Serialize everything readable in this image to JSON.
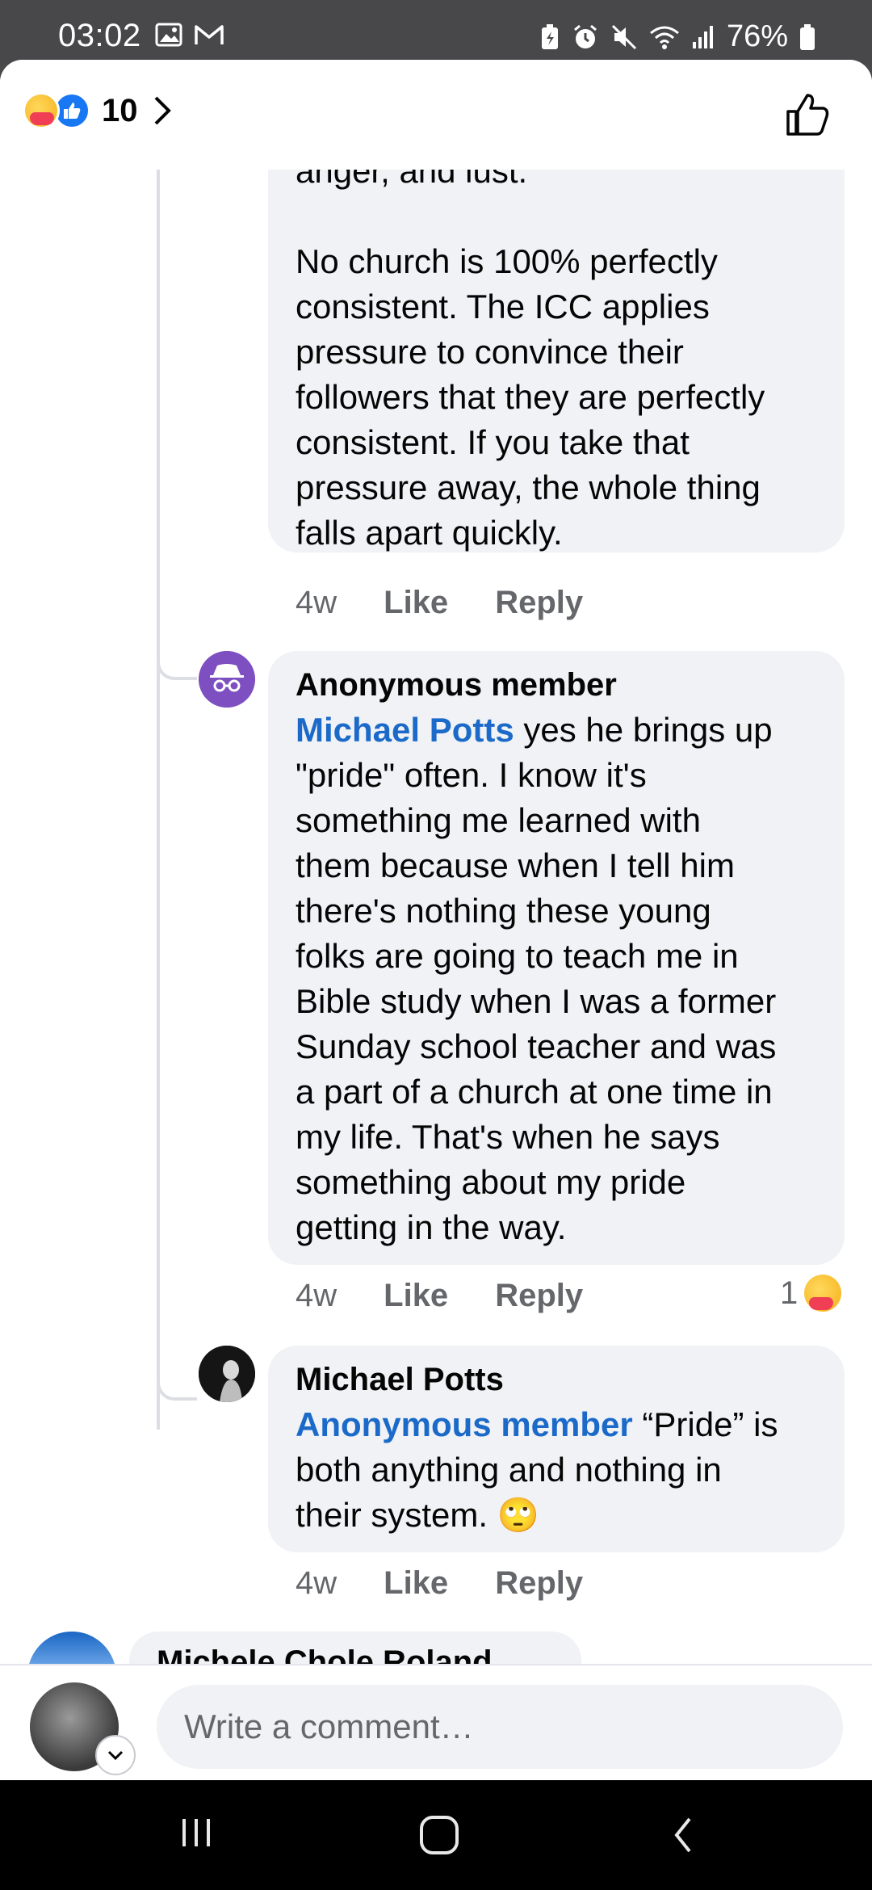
{
  "status_bar": {
    "time": "03:02",
    "battery": "76%",
    "icons": [
      "gallery-icon",
      "gmail-icon",
      "battery-saver-icon",
      "alarm-icon",
      "mute-icon",
      "wifi-icon",
      "signal-icon",
      "battery-icon"
    ]
  },
  "header": {
    "reaction_count": "10",
    "reaction_icons": [
      "care-reaction-icon",
      "like-reaction-icon"
    ]
  },
  "comments": [
    {
      "author": "",
      "text_lines": [
        "anger, and lust.",
        "",
        "No church is 100% perfectly",
        "consistent. The ICC applies",
        "pressure to convince their",
        "followers that they are perfectly",
        "consistent. If you take that",
        "pressure away, the whole thing",
        "falls apart quickly."
      ],
      "time": "4w",
      "like_label": "Like",
      "reply_label": "Reply"
    },
    {
      "author": "Anonymous member",
      "mention": "Michael Potts",
      "text_first": " yes he brings up",
      "text_lines": [
        "\"pride\" often. I know it's",
        "something me learned with",
        "them because when I tell him",
        "there's nothing these young",
        "folks are going to teach me in",
        "Bible study when I was a former",
        "Sunday school teacher and was",
        "a part of a church at one time in",
        "my life. That's when he says",
        "something about my pride",
        "getting in the way."
      ],
      "time": "4w",
      "like_label": "Like",
      "reply_label": "Reply",
      "reaction_count": "1"
    },
    {
      "author": "Michael Potts",
      "mention": "Anonymous member",
      "text_first": " “Pride” is",
      "text_lines": [
        "both anything and nothing in",
        "their system. 🙄"
      ],
      "time": "4w",
      "like_label": "Like",
      "reply_label": "Reply"
    }
  ],
  "next_comment_author": "Michele Chole Roland",
  "composer": {
    "placeholder": "Write a comment…"
  },
  "colors": {
    "mention": "#1b6ac9",
    "bubble": "#f0f2f5",
    "meta": "#65676b",
    "like_blue": "#1877f2"
  }
}
